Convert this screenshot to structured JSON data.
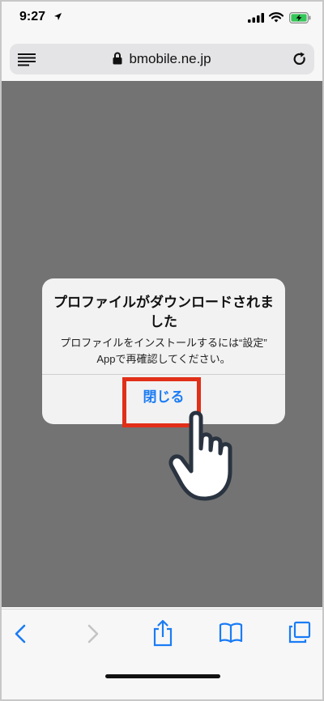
{
  "status_bar": {
    "time": "9:27",
    "icons": [
      "location-arrow-icon",
      "signal-bars-icon",
      "wifi-icon",
      "battery-charging-icon"
    ]
  },
  "address_bar": {
    "domain": "bmobile.ne.jp",
    "icons": [
      "reader-list-icon",
      "lock-icon",
      "reload-icon"
    ]
  },
  "alert": {
    "title": "プロファイルがダウンロードされました",
    "message": "プロファイルをインストールするには“設定” Appで再確認してください。",
    "button_label": "閉じる"
  },
  "toolbar": {
    "icons": [
      "back-icon",
      "forward-icon",
      "share-icon",
      "bookmarks-icon",
      "tabs-icon"
    ]
  },
  "colors": {
    "accent": "#1a7cf5",
    "highlight": "#e12f18",
    "overlay": "#737373",
    "battery_green": "#34c759"
  }
}
